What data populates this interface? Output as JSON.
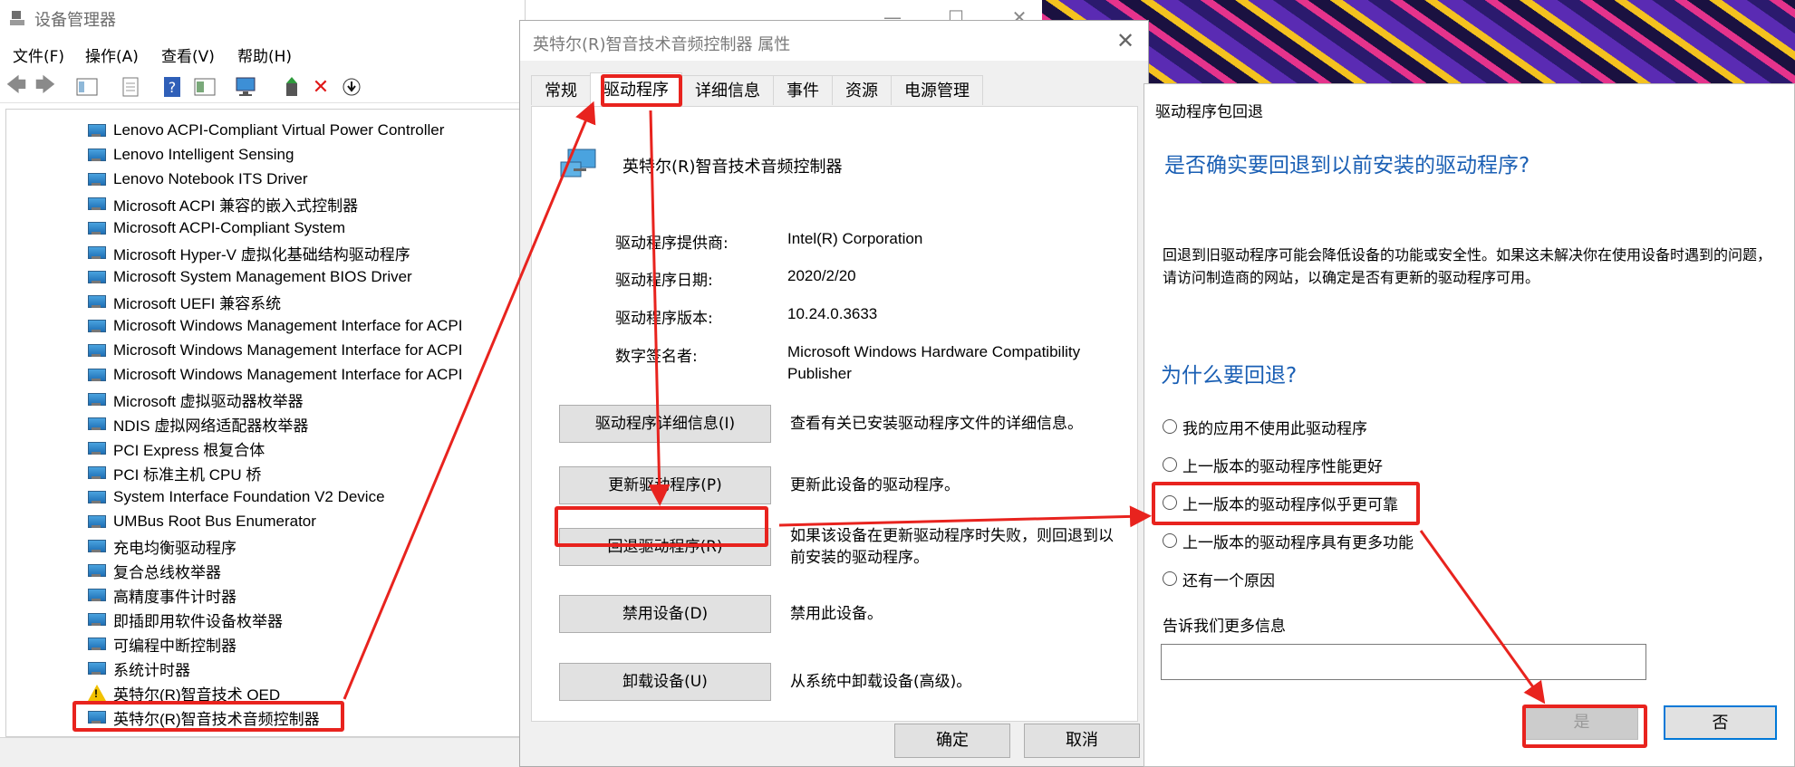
{
  "device_manager": {
    "title": "设备管理器",
    "menu": [
      "文件(F)",
      "操作(A)",
      "查看(V)",
      "帮助(H)"
    ],
    "toolbar_icons": [
      "back-arrow-icon",
      "forward-arrow-icon",
      "properties-view-icon",
      "document-icon",
      "help-icon",
      "details-view-icon",
      "monitor-scan-icon",
      "add-driver-icon",
      "remove-device-icon",
      "download-icon"
    ],
    "devices": [
      "Lenovo ACPI-Compliant Virtual Power Controller",
      "Lenovo Intelligent Sensing",
      "Lenovo Notebook ITS Driver",
      "Microsoft ACPI 兼容的嵌入式控制器",
      "Microsoft ACPI-Compliant System",
      "Microsoft Hyper-V 虚拟化基础结构驱动程序",
      "Microsoft System Management BIOS Driver",
      "Microsoft UEFI 兼容系统",
      "Microsoft Windows Management Interface for ACPI",
      "Microsoft Windows Management Interface for ACPI",
      "Microsoft Windows Management Interface for ACPI",
      "Microsoft 虚拟驱动器枚举器",
      "NDIS 虚拟网络适配器枚举器",
      "PCI Express 根复合体",
      "PCI 标准主机 CPU 桥",
      "System Interface Foundation V2 Device",
      "UMBus Root Bus Enumerator",
      "充电均衡驱动程序",
      "复合总线枚举器",
      "高精度事件计时器",
      "即插即用软件设备枚举器",
      "可编程中断控制器",
      "系统计时器",
      "英特尔(R)智音技术 OED",
      "英特尔(R)智音技术音频控制器"
    ]
  },
  "properties": {
    "title": "英特尔(R)智音技术音频控制器 属性",
    "tabs": [
      "常规",
      "驱动程序",
      "详细信息",
      "事件",
      "资源",
      "电源管理"
    ],
    "device_name": "英特尔(R)智音技术音频控制器",
    "provider_label": "驱动程序提供商:",
    "provider_value": "Intel(R) Corporation",
    "date_label": "驱动程序日期:",
    "date_value": "2020/2/20",
    "version_label": "驱动程序版本:",
    "version_value": "10.24.0.3633",
    "signer_label": "数字签名者:",
    "signer_value": "Microsoft Windows Hardware Compatibility Publisher",
    "details_button": "驱动程序详细信息(I)",
    "details_desc": "查看有关已安装驱动程序文件的详细信息。",
    "update_button": "更新驱动程序(P)",
    "update_desc": "更新此设备的驱动程序。",
    "rollback_button": "回退驱动程序(R)",
    "rollback_desc": "如果该设备在更新驱动程序时失败，则回退到以前安装的驱动程序。",
    "disable_button": "禁用设备(D)",
    "disable_desc": "禁用此设备。",
    "uninstall_button": "卸载设备(U)",
    "uninstall_desc": "从系统中卸载设备(高级)。",
    "ok_button": "确定",
    "cancel_button": "取消"
  },
  "rollback_dialog": {
    "title": "驱动程序包回退",
    "question": "是否确实要回退到以前安装的驱动程序?",
    "explanation": "回退到旧驱动程序可能会降低设备的功能或安全性。如果这未解决你在使用设备时遇到的问题，请访问制造商的网站，以确定是否有更新的驱动程序可用。",
    "why_heading": "为什么要回退?",
    "reasons": [
      "我的应用不使用此驱动程序",
      "上一版本的驱动程序性能更好",
      "上一版本的驱动程序似乎更可靠",
      "上一版本的驱动程序具有更多功能",
      "还有一个原因"
    ],
    "more_info_label": "告诉我们更多信息",
    "more_info_value": "",
    "yes_button": "是",
    "no_button": "否"
  },
  "annotation_color": "#e8231e",
  "accent_color": "#1a5fb4"
}
